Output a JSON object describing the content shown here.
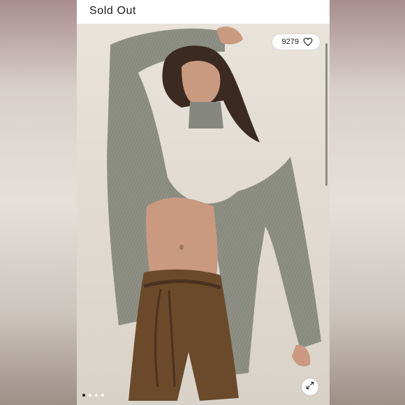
{
  "listing": {
    "status_label": "Sold Out",
    "like_count": "9279",
    "icons": {
      "like": "heart-outline-icon",
      "expand": "expand-arrows-icon"
    }
  },
  "carousel": {
    "total_slides": 4,
    "active_index": 0
  },
  "colors": {
    "sweater": "#8e9086",
    "shorts": "#6b4a2b",
    "background": "#e3ddd4",
    "skin": "#c99a7f",
    "hair": "#3a2a22"
  }
}
